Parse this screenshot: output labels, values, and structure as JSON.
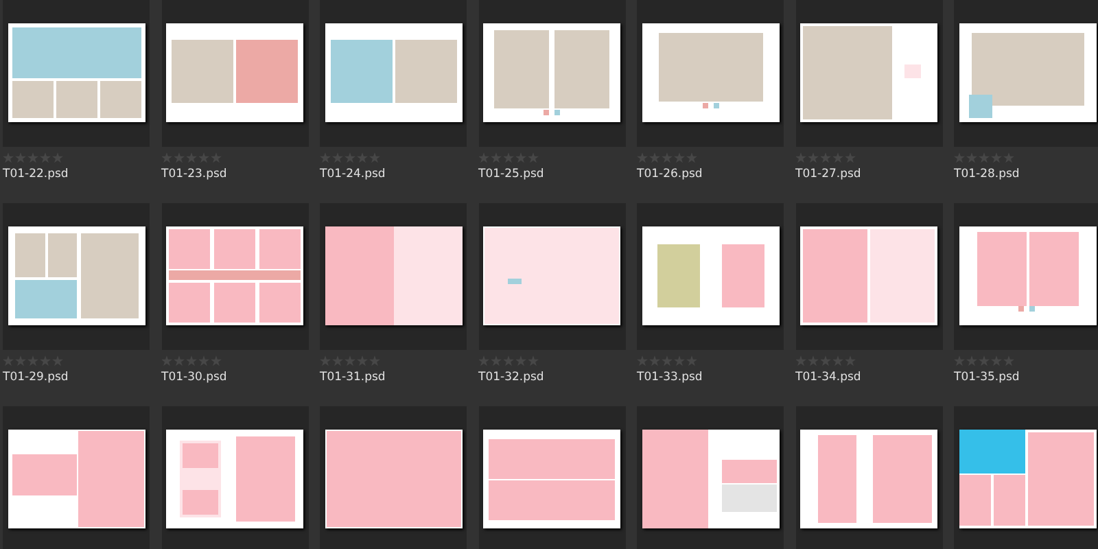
{
  "thumbnails": [
    {
      "name": "T01-22.psd",
      "stars": 0,
      "kind": "picture"
    },
    {
      "name": "T01-23.psd",
      "stars": 0,
      "kind": "picture"
    },
    {
      "name": "T01-24.psd",
      "stars": 0,
      "kind": "picture"
    },
    {
      "name": "T01-25.psd",
      "stars": 0,
      "kind": "picture"
    },
    {
      "name": "T01-26.psd",
      "stars": 0,
      "kind": "picture"
    },
    {
      "name": "T01-27.psd",
      "stars": 0,
      "kind": "picture"
    },
    {
      "name": "T01-28.psd",
      "stars": 0,
      "kind": "picture"
    },
    {
      "name": "T01-29.psd",
      "stars": 0,
      "kind": "picture"
    },
    {
      "name": "T01-30.psd",
      "stars": 0,
      "kind": "picture"
    },
    {
      "name": "T01-31.psd",
      "stars": 0,
      "kind": "picture"
    },
    {
      "name": "T01-32.psd",
      "stars": 0,
      "kind": "picture"
    },
    {
      "name": "T01-33.psd",
      "stars": 0,
      "kind": "picture"
    },
    {
      "name": "T01-34.psd",
      "stars": 0,
      "kind": "picture"
    },
    {
      "name": "T01-35.psd",
      "stars": 0,
      "kind": "picture"
    },
    {
      "kind": "picture"
    },
    {
      "kind": "picture"
    },
    {
      "kind": "picture"
    },
    {
      "kind": "picture"
    },
    {
      "kind": "picture"
    },
    {
      "kind": "picture"
    },
    {
      "kind": "picture"
    }
  ]
}
